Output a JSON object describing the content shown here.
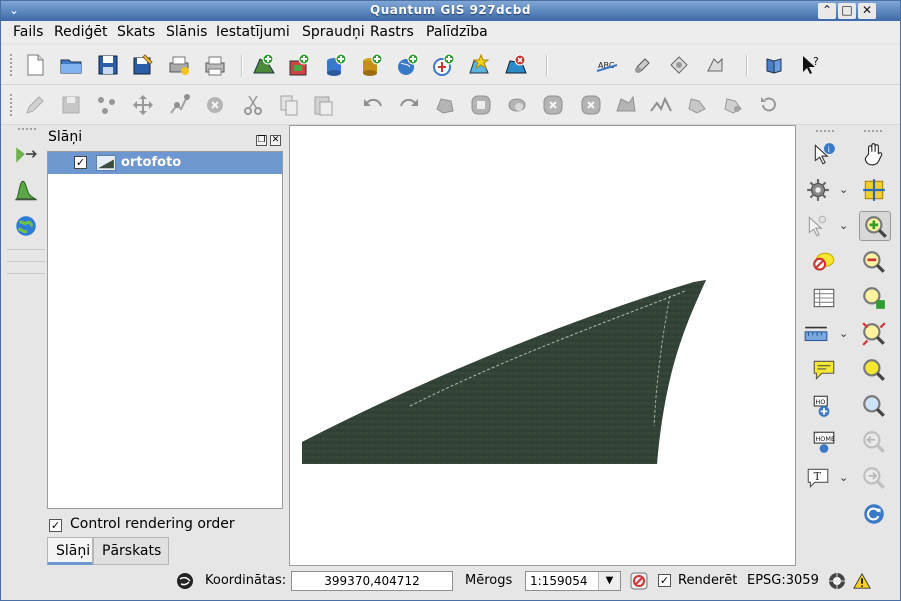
{
  "window": {
    "title": "Quantum GIS 927dcbd"
  },
  "menu": [
    "Fails",
    "Rediģēt",
    "Skats",
    "Slānis",
    "Iestatījumi",
    "Spraudņi",
    "Rastrs",
    "Palīdzība"
  ],
  "menu_underlines": [
    "F",
    "R",
    "S",
    "l",
    "I",
    "S",
    "R",
    "P"
  ],
  "toolbar_file": [
    "new-project-icon",
    "open-project-icon",
    "save-project-icon",
    "save-as-icon",
    "print-composer-icon",
    "print-icon",
    "add-vector-layer-icon",
    "add-raster-layer-icon",
    "add-postgis-layer-icon",
    "add-spatialite-layer-icon",
    "add-wms-layer-icon",
    "add-wfs-layer-icon",
    "new-vector-layer-icon",
    "remove-layer-icon",
    "abc-label-icon",
    "plugin-icon",
    "plugin-icon-2",
    "plugin-icon-3",
    "help-book-icon",
    "whats-this-icon"
  ],
  "toolbar_edit": [
    "pencil-icon",
    "save-edits-icon",
    "capture-point-icon",
    "move-feature-icon",
    "node-tool-icon",
    "delete-selected-icon",
    "cut-icon",
    "copy-icon",
    "paste-icon",
    "undo-icon",
    "redo-icon",
    "simplify-icon",
    "add-ring-icon",
    "add-island-icon",
    "delete-ring-icon",
    "delete-part-icon",
    "reshape-icon",
    "split-features-icon",
    "merge-features-icon",
    "merge-attributes-icon",
    "rotate-point-icon"
  ],
  "panel": {
    "title": "Slāņi",
    "layer_name": "ortofoto",
    "layer_checked": "✓",
    "control_rendering": "Control rendering order",
    "control_checked": "✓",
    "tabs": [
      "Slāņi",
      "Pārskats"
    ]
  },
  "right_tools": [
    "identify-icon",
    "pan-icon",
    "gear-icon",
    "zoom-next-icon",
    "select-icon",
    "zoom-in-icon",
    "deselect-icon",
    "zoom-out-icon",
    "attribute-table-icon",
    "zoom-layer-icon",
    "measure-icon",
    "zoom-full-icon",
    "map-tips-icon",
    "zoom-selection-icon",
    "new-bookmark-icon",
    "zoom-last-icon",
    "show-bookmarks-icon",
    "zoom-back-icon",
    "text-annotation-icon",
    "zoom-forward-icon",
    "refresh-icon"
  ],
  "status": {
    "coords_label": "Koordinātas:",
    "coords_value": "399370,404712",
    "scale_label": "Mērogs",
    "scale_value": "1:159054",
    "render_label": "Renderēt",
    "render_checked": "✓",
    "crs": "EPSG:3059"
  },
  "colors": {
    "selection": "#6f97cf",
    "titlebar": "#3d6aa8",
    "ortho": "#2b3a2f"
  }
}
